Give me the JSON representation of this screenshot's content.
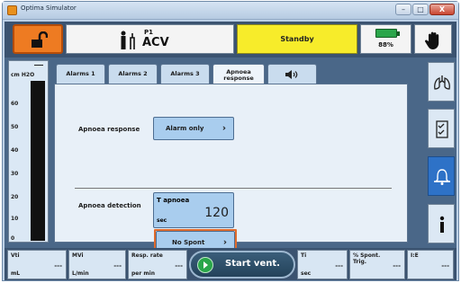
{
  "window": {
    "title": "Optima Simulator",
    "buttons": {
      "minimize": "–",
      "maximize": "□",
      "close": "X"
    }
  },
  "topbar": {
    "patient_id": "P1",
    "mode": "ACV",
    "status": "Standby",
    "battery_percent": "88%"
  },
  "pressure_bar": {
    "unit": "cm H2O",
    "ticks": [
      "60",
      "50",
      "40",
      "30",
      "20",
      "10",
      "0"
    ]
  },
  "tabs": [
    {
      "label": "Alarms 1"
    },
    {
      "label": "Alarms 2"
    },
    {
      "label": "Alarms 3"
    },
    {
      "label": "Apnoea response"
    }
  ],
  "panel": {
    "apnoea_response_label": "Apnoea response",
    "apnoea_response_value": "Alarm only",
    "apnoea_detection_label": "Apnoea detection",
    "t_apnoea_label": "T apnoea",
    "t_apnoea_unit": "sec",
    "t_apnoea_value": "120",
    "no_spont_label": "No Spont"
  },
  "bottom": {
    "vti": {
      "label": "Vti",
      "unit": "mL",
      "value": "---"
    },
    "mvi": {
      "label": "MVi",
      "unit": "L/min",
      "value": "---"
    },
    "resp_rate": {
      "label": "Resp. rate",
      "unit": "per min",
      "value": "---"
    },
    "start_vent": "Start vent.",
    "ti": {
      "label": "Ti",
      "unit": "sec",
      "value": "---"
    },
    "spont_trig": {
      "label": "% Spont. Trig.",
      "value": "---"
    },
    "ie": {
      "label": "I:E",
      "value": "---"
    }
  },
  "colors": {
    "lock_orange": "#ee7b22",
    "standby_yellow": "#f7ec2a",
    "battery_green": "#2aa64a",
    "highlight_orange": "#e06b2c",
    "active_side_blue": "#2e72c7"
  }
}
